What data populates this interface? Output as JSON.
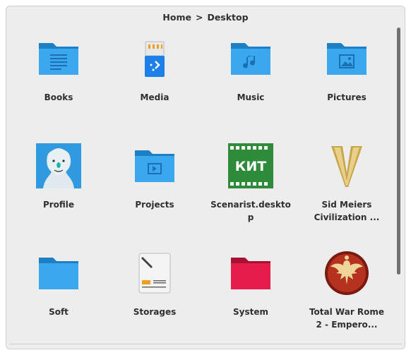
{
  "breadcrumb": {
    "home": "Home",
    "separator": ">",
    "current": "Desktop"
  },
  "items": [
    {
      "label": "Books",
      "icon": "folder-documents-icon"
    },
    {
      "label": "Media",
      "icon": "usb-drive-icon"
    },
    {
      "label": "Music",
      "icon": "folder-music-icon"
    },
    {
      "label": "Pictures",
      "icon": "folder-pictures-icon"
    },
    {
      "label": "Profile",
      "icon": "user-avatar-icon"
    },
    {
      "label": "Projects",
      "icon": "folder-videos-icon"
    },
    {
      "label": "Scenarist.deskto\np",
      "icon": "kit-app-icon",
      "icon_text": "КИТ"
    },
    {
      "label": "Sid Meiers\nCivilization ...",
      "icon": "civilization-v-icon",
      "icon_text": "V"
    },
    {
      "label": "Soft",
      "icon": "folder-icon"
    },
    {
      "label": "Storages",
      "icon": "disk-storage-icon"
    },
    {
      "label": "System",
      "icon": "folder-system-red-icon"
    },
    {
      "label": "Total War Rome\n2 - Empero...",
      "icon": "rome-eagle-emblem-icon"
    }
  ],
  "colors": {
    "folder_blue": "#2f9ae0",
    "folder_front": "#40adf0",
    "folder_red": "#e61c4d",
    "kit_green": "#2e8b3a"
  }
}
